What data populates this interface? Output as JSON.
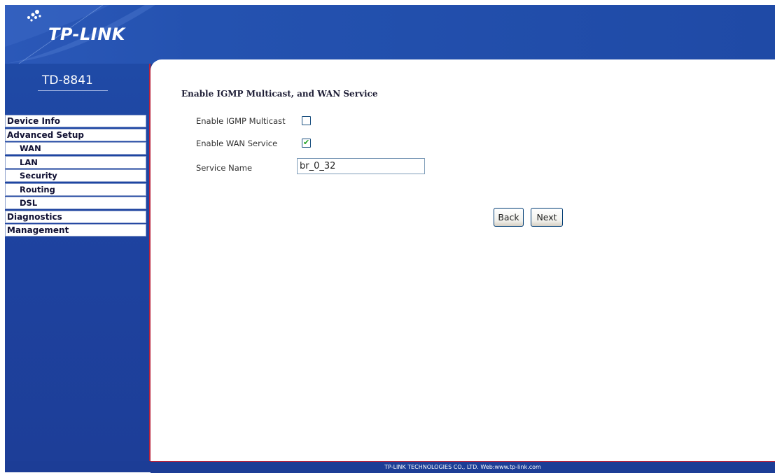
{
  "brand": {
    "logo_text": "TP-LINK",
    "model": "TD-8841"
  },
  "nav": {
    "items": [
      {
        "label": "Device Info",
        "level": 0
      },
      {
        "label": "Advanced Setup",
        "level": 0
      },
      {
        "label": "WAN",
        "level": 1
      },
      {
        "label": "LAN",
        "level": 1
      },
      {
        "label": "Security",
        "level": 1
      },
      {
        "label": "Routing",
        "level": 1
      },
      {
        "label": "DSL",
        "level": 1
      },
      {
        "label": "Diagnostics",
        "level": 0
      },
      {
        "label": "Management",
        "level": 0
      }
    ]
  },
  "page": {
    "title": "Enable IGMP Multicast, and WAN Service",
    "igmp": {
      "label": "Enable IGMP Multicast",
      "checked": false
    },
    "wan": {
      "label": "Enable WAN Service",
      "checked": true
    },
    "service_name": {
      "label": "Service Name",
      "value": "br_0_32"
    },
    "back_label": "Back",
    "next_label": "Next"
  },
  "footer": {
    "text": "TP-LINK TECHNOLOGIES CO., LTD. Web:www.tp-link.com"
  },
  "colors": {
    "brand_blue": "#1e3f96",
    "accent_red": "#b8233c",
    "check_green": "#21a121"
  }
}
